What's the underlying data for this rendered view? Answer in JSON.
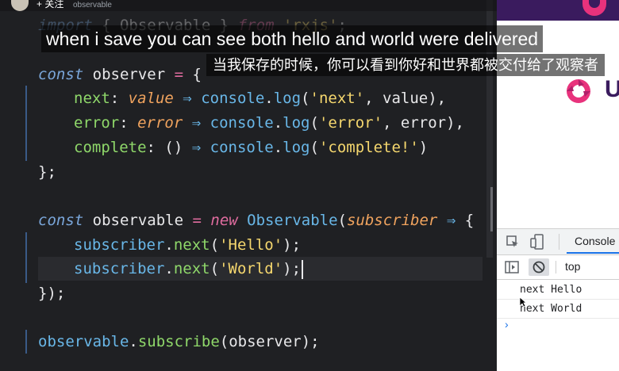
{
  "top_bar": {
    "follow_label": "+ 关注",
    "tab_name": "observable"
  },
  "code": {
    "line1": {
      "kw": "import",
      "open": " { ",
      "name": "Observable",
      "close": " } ",
      "from": "from",
      "mod": "'rxjs'",
      "semi": ";"
    },
    "line3": {
      "kw": "const",
      "name": " observer ",
      "eq": "=",
      "rest": " {"
    },
    "line4": {
      "prop": "next",
      "colon": ": ",
      "param": "value",
      "arrow": " ⇒ ",
      "obj": "console",
      "dot": ".",
      "method": "log",
      "open": "(",
      "str": "'next'",
      "rest": ", value),"
    },
    "line5": {
      "prop": "error",
      "colon": ": ",
      "param": "error",
      "arrow": " ⇒ ",
      "obj": "console",
      "dot": ".",
      "method": "log",
      "open": "(",
      "str": "'error'",
      "rest": ", error),"
    },
    "line6": {
      "prop": "complete",
      "colon": ": ",
      "parens": "()",
      "arrow": " ⇒ ",
      "obj": "console",
      "dot": ".",
      "method": "log",
      "open": "(",
      "str": "'complete!'",
      "rest": ")"
    },
    "line7": "};",
    "line9": {
      "kw": "const",
      "name": " observable ",
      "eq": "=",
      "new": " new ",
      "cls": "Observable",
      "open": "(",
      "param": "subscriber",
      "arrow": " ⇒ ",
      "rest": "{"
    },
    "line10": {
      "obj": "subscriber",
      "dot": ".",
      "method": "next",
      "open": "(",
      "str": "'Hello'",
      "rest": ");"
    },
    "line11": {
      "obj": "subscriber",
      "dot": ".",
      "method": "next",
      "open": "(",
      "str": "'World'",
      "rest": ");"
    },
    "line12": "});",
    "line14": {
      "obj": "observable",
      "dot": ".",
      "method": "subscribe",
      "rest": "(observer);"
    }
  },
  "subtitles": {
    "english": "when i save you can see both hello and world were delivered",
    "chinese": "当我保存的时候，你可以看到你好和世界都被交付给了观察者"
  },
  "devtools": {
    "tab_console": "Console",
    "context": "top",
    "logs": [
      "next Hello",
      "next World"
    ],
    "prompt": "›"
  },
  "page": {
    "brand_letter": "U"
  },
  "colors": {
    "accent": "#1a73e8",
    "rx_pink": "#e8327c",
    "rx_purple": "#3a1b5e"
  }
}
